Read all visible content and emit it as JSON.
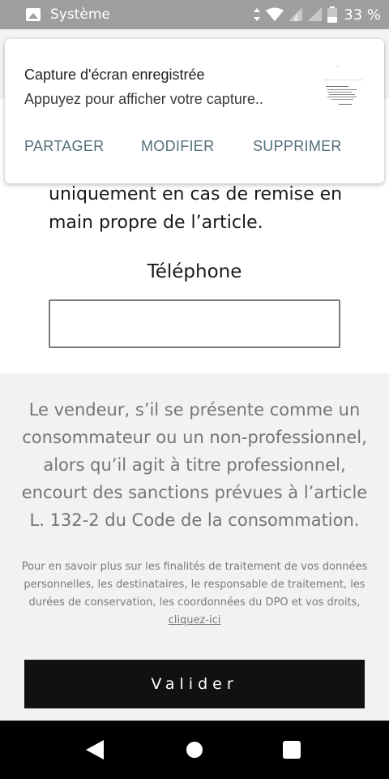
{
  "status_bar": {
    "app_icon": "image-icon",
    "app_name": "Système",
    "battery_text": "33 %"
  },
  "notification": {
    "title": "Capture d'écran enregistrée",
    "body": "Appuyez pour afficher votre capture..",
    "actions": {
      "share": "PARTAGER",
      "edit": "MODIFIER",
      "delete": "SUPPRIMER"
    },
    "accent_color": "#546e7a"
  },
  "form": {
    "intro_text_line1": "uniquement en cas de remise en",
    "intro_text_line2": "main propre de l’article.",
    "phone_label": "Téléphone",
    "phone_value": "",
    "legal_text": "Le vendeur, s’il se présente comme un consommateur ou un non-professionnel, alors qu’il agit à titre professionnel, encourt des sanctions prévues à l’article L. 132-2 du Code de la consommation.",
    "privacy_text": "Pour en savoir plus sur les finalités de traitement de vos données personnelles, les destinataires, le responsable de traitement, les durées de conservation, les coordonnées du DPO et vos droits,",
    "privacy_link": "cliquez-ici",
    "submit_label": "Valider"
  },
  "nav_bar": {
    "back_icon": "back-triangle-icon",
    "home_icon": "home-circle-icon",
    "recent_icon": "recent-apps-square-icon"
  },
  "colors": {
    "status_bar": "#9e9e9e",
    "page_grey": "#f2f2f2",
    "button_bg": "#111111",
    "nav_bar": "#000000"
  }
}
